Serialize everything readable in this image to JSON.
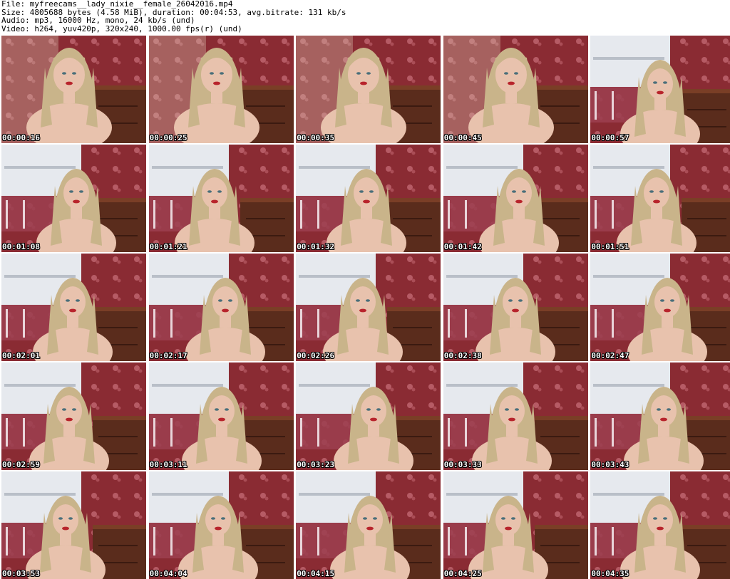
{
  "header": {
    "file_line": "File: myfreecams__lady_nixie__female_26042016.mp4",
    "size_line": "Size: 4805688 bytes (4.58 MiB), duration: 00:04:53, avg.bitrate: 131 kb/s",
    "audio_line": "Audio: mp3, 16000 Hz, mono, 24 kb/s (und)",
    "video_line": "Video: h264, yuv420p, 320x240, 1000.00 fps(r) (und)"
  },
  "frames": [
    {
      "timestamp": "00:00:16"
    },
    {
      "timestamp": "00:00:25"
    },
    {
      "timestamp": "00:00:35"
    },
    {
      "timestamp": "00:00:45"
    },
    {
      "timestamp": "00:00:57"
    },
    {
      "timestamp": "00:01:08"
    },
    {
      "timestamp": "00:01:21"
    },
    {
      "timestamp": "00:01:32"
    },
    {
      "timestamp": "00:01:42"
    },
    {
      "timestamp": "00:01:51"
    },
    {
      "timestamp": "00:02:01"
    },
    {
      "timestamp": "00:02:17"
    },
    {
      "timestamp": "00:02:26"
    },
    {
      "timestamp": "00:02:38"
    },
    {
      "timestamp": "00:02:47"
    },
    {
      "timestamp": "00:02:59"
    },
    {
      "timestamp": "00:03:11"
    },
    {
      "timestamp": "00:03:23"
    },
    {
      "timestamp": "00:03:33"
    },
    {
      "timestamp": "00:03:43"
    },
    {
      "timestamp": "00:03:53"
    },
    {
      "timestamp": "00:04:04"
    },
    {
      "timestamp": "00:04:15"
    },
    {
      "timestamp": "00:04:25"
    },
    {
      "timestamp": "00:04:35"
    }
  ],
  "colors": {
    "wallpaper": "#8a2b33",
    "wallpaper_pattern": "#c9707a",
    "wardrobe": "#e6e9ee",
    "wood": "#5a2c1c",
    "hair": "#c9b48a",
    "skin": "#e8c2ad",
    "lips": "#b8242c"
  }
}
